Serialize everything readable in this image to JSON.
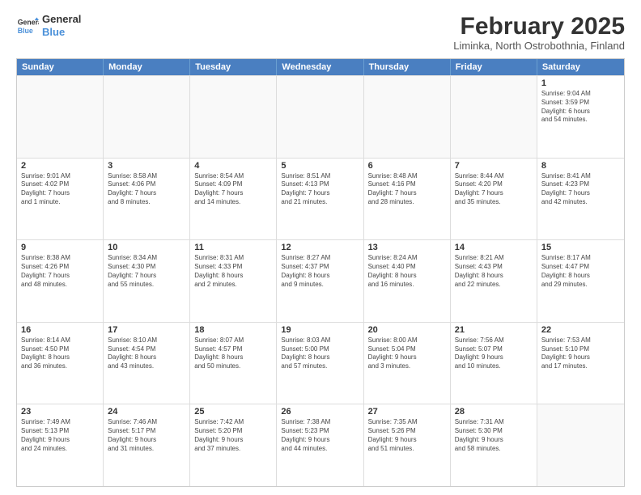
{
  "logo": {
    "line1": "General",
    "line2": "Blue"
  },
  "title": "February 2025",
  "subtitle": "Liminka, North Ostrobothnia, Finland",
  "header": {
    "days": [
      "Sunday",
      "Monday",
      "Tuesday",
      "Wednesday",
      "Thursday",
      "Friday",
      "Saturday"
    ]
  },
  "weeks": [
    [
      {
        "day": "",
        "info": ""
      },
      {
        "day": "",
        "info": ""
      },
      {
        "day": "",
        "info": ""
      },
      {
        "day": "",
        "info": ""
      },
      {
        "day": "",
        "info": ""
      },
      {
        "day": "",
        "info": ""
      },
      {
        "day": "1",
        "info": "Sunrise: 9:04 AM\nSunset: 3:59 PM\nDaylight: 6 hours\nand 54 minutes."
      }
    ],
    [
      {
        "day": "2",
        "info": "Sunrise: 9:01 AM\nSunset: 4:02 PM\nDaylight: 7 hours\nand 1 minute."
      },
      {
        "day": "3",
        "info": "Sunrise: 8:58 AM\nSunset: 4:06 PM\nDaylight: 7 hours\nand 8 minutes."
      },
      {
        "day": "4",
        "info": "Sunrise: 8:54 AM\nSunset: 4:09 PM\nDaylight: 7 hours\nand 14 minutes."
      },
      {
        "day": "5",
        "info": "Sunrise: 8:51 AM\nSunset: 4:13 PM\nDaylight: 7 hours\nand 21 minutes."
      },
      {
        "day": "6",
        "info": "Sunrise: 8:48 AM\nSunset: 4:16 PM\nDaylight: 7 hours\nand 28 minutes."
      },
      {
        "day": "7",
        "info": "Sunrise: 8:44 AM\nSunset: 4:20 PM\nDaylight: 7 hours\nand 35 minutes."
      },
      {
        "day": "8",
        "info": "Sunrise: 8:41 AM\nSunset: 4:23 PM\nDaylight: 7 hours\nand 42 minutes."
      }
    ],
    [
      {
        "day": "9",
        "info": "Sunrise: 8:38 AM\nSunset: 4:26 PM\nDaylight: 7 hours\nand 48 minutes."
      },
      {
        "day": "10",
        "info": "Sunrise: 8:34 AM\nSunset: 4:30 PM\nDaylight: 7 hours\nand 55 minutes."
      },
      {
        "day": "11",
        "info": "Sunrise: 8:31 AM\nSunset: 4:33 PM\nDaylight: 8 hours\nand 2 minutes."
      },
      {
        "day": "12",
        "info": "Sunrise: 8:27 AM\nSunset: 4:37 PM\nDaylight: 8 hours\nand 9 minutes."
      },
      {
        "day": "13",
        "info": "Sunrise: 8:24 AM\nSunset: 4:40 PM\nDaylight: 8 hours\nand 16 minutes."
      },
      {
        "day": "14",
        "info": "Sunrise: 8:21 AM\nSunset: 4:43 PM\nDaylight: 8 hours\nand 22 minutes."
      },
      {
        "day": "15",
        "info": "Sunrise: 8:17 AM\nSunset: 4:47 PM\nDaylight: 8 hours\nand 29 minutes."
      }
    ],
    [
      {
        "day": "16",
        "info": "Sunrise: 8:14 AM\nSunset: 4:50 PM\nDaylight: 8 hours\nand 36 minutes."
      },
      {
        "day": "17",
        "info": "Sunrise: 8:10 AM\nSunset: 4:54 PM\nDaylight: 8 hours\nand 43 minutes."
      },
      {
        "day": "18",
        "info": "Sunrise: 8:07 AM\nSunset: 4:57 PM\nDaylight: 8 hours\nand 50 minutes."
      },
      {
        "day": "19",
        "info": "Sunrise: 8:03 AM\nSunset: 5:00 PM\nDaylight: 8 hours\nand 57 minutes."
      },
      {
        "day": "20",
        "info": "Sunrise: 8:00 AM\nSunset: 5:04 PM\nDaylight: 9 hours\nand 3 minutes."
      },
      {
        "day": "21",
        "info": "Sunrise: 7:56 AM\nSunset: 5:07 PM\nDaylight: 9 hours\nand 10 minutes."
      },
      {
        "day": "22",
        "info": "Sunrise: 7:53 AM\nSunset: 5:10 PM\nDaylight: 9 hours\nand 17 minutes."
      }
    ],
    [
      {
        "day": "23",
        "info": "Sunrise: 7:49 AM\nSunset: 5:13 PM\nDaylight: 9 hours\nand 24 minutes."
      },
      {
        "day": "24",
        "info": "Sunrise: 7:46 AM\nSunset: 5:17 PM\nDaylight: 9 hours\nand 31 minutes."
      },
      {
        "day": "25",
        "info": "Sunrise: 7:42 AM\nSunset: 5:20 PM\nDaylight: 9 hours\nand 37 minutes."
      },
      {
        "day": "26",
        "info": "Sunrise: 7:38 AM\nSunset: 5:23 PM\nDaylight: 9 hours\nand 44 minutes."
      },
      {
        "day": "27",
        "info": "Sunrise: 7:35 AM\nSunset: 5:26 PM\nDaylight: 9 hours\nand 51 minutes."
      },
      {
        "day": "28",
        "info": "Sunrise: 7:31 AM\nSunset: 5:30 PM\nDaylight: 9 hours\nand 58 minutes."
      },
      {
        "day": "",
        "info": ""
      }
    ]
  ]
}
